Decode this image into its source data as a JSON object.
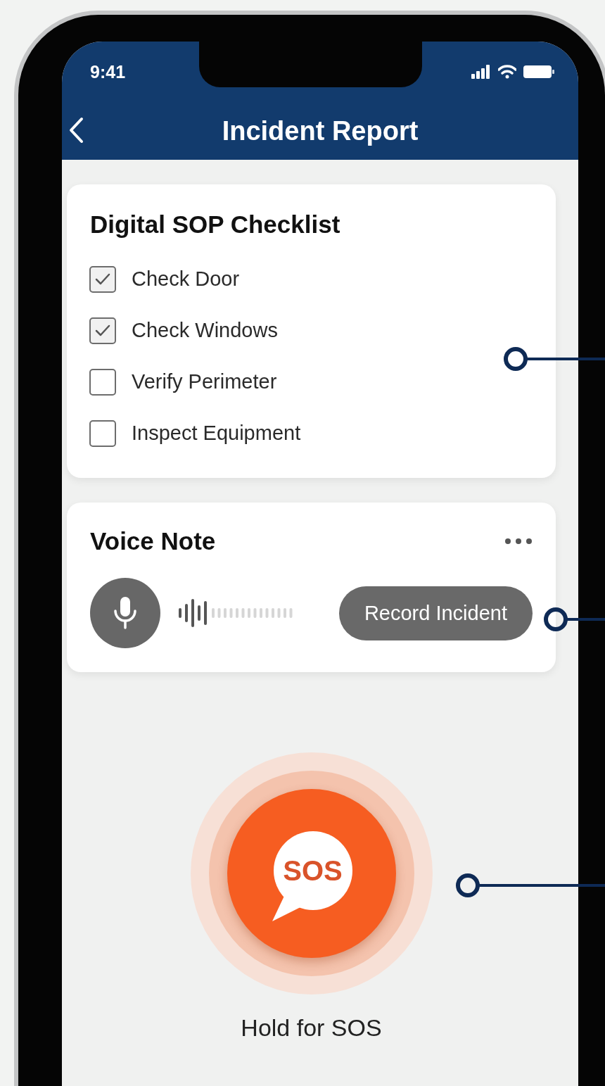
{
  "status_bar": {
    "time": "9:41"
  },
  "header": {
    "title": "Incident Report"
  },
  "checklist": {
    "title": "Digital SOP Checklist",
    "items": [
      {
        "label": "Check Door",
        "checked": true
      },
      {
        "label": "Check Windows",
        "checked": true
      },
      {
        "label": "Verify Perimeter",
        "checked": false
      },
      {
        "label": "Inspect Equipment",
        "checked": false
      }
    ]
  },
  "voice_note": {
    "title": "Voice Note",
    "button": "Record Incident"
  },
  "sos": {
    "badge": "SOS",
    "caption": "Hold for SOS"
  }
}
